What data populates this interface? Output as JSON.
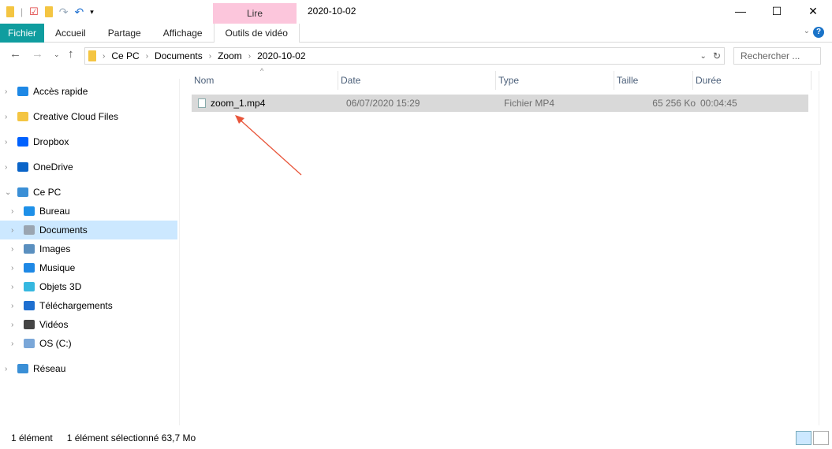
{
  "window": {
    "title": "2020-10-02",
    "minimize": "—",
    "maximize": "☐",
    "close": "✕"
  },
  "ribbon": {
    "context_label": "Lire",
    "tabs": [
      "Fichier",
      "Accueil",
      "Partage",
      "Affichage",
      "Outils de vidéo"
    ],
    "help": "?"
  },
  "address": {
    "breadcrumb": [
      "Ce PC",
      "Documents",
      "Zoom",
      "2020-10-02"
    ],
    "search_placeholder": "Rechercher ..."
  },
  "sidebar": {
    "items": [
      {
        "label": "Accès rapide",
        "icon": "star-icon",
        "color": "#1e88e5"
      },
      {
        "label": "Creative Cloud Files",
        "icon": "creative-cloud-icon",
        "color": "#f4c542"
      },
      {
        "label": "Dropbox",
        "icon": "dropbox-icon",
        "color": "#0061fe"
      },
      {
        "label": "OneDrive",
        "icon": "onedrive-icon",
        "color": "#0a64c8"
      },
      {
        "label": "Ce PC",
        "icon": "computer-icon",
        "color": "#3a8fd6"
      },
      {
        "label": "Bureau",
        "icon": "desktop-icon",
        "color": "#1e90e8"
      },
      {
        "label": "Documents",
        "icon": "documents-icon",
        "color": "#9aa5b1"
      },
      {
        "label": "Images",
        "icon": "images-icon",
        "color": "#5a8fbf"
      },
      {
        "label": "Musique",
        "icon": "music-icon",
        "color": "#1e88e5"
      },
      {
        "label": "Objets 3D",
        "icon": "cube-icon",
        "color": "#36b8e0"
      },
      {
        "label": "Téléchargements",
        "icon": "download-icon",
        "color": "#1e6fd0"
      },
      {
        "label": "Vidéos",
        "icon": "video-icon",
        "color": "#444444"
      },
      {
        "label": "OS (C:)",
        "icon": "drive-icon",
        "color": "#7aa7d8"
      },
      {
        "label": "Réseau",
        "icon": "network-icon",
        "color": "#3a8fd6"
      }
    ]
  },
  "columns": [
    "Nom",
    "Date",
    "Type",
    "Taille",
    "Durée"
  ],
  "files": [
    {
      "name": "zoom_1.mp4",
      "date": "06/07/2020 15:29",
      "type": "Fichier MP4",
      "size": "65 256 Ko",
      "duration": "00:04:45"
    }
  ],
  "status": {
    "count": "1 élément",
    "selection": "1 élément sélectionné 63,7 Mo"
  },
  "annotation_color": "#e8553a"
}
